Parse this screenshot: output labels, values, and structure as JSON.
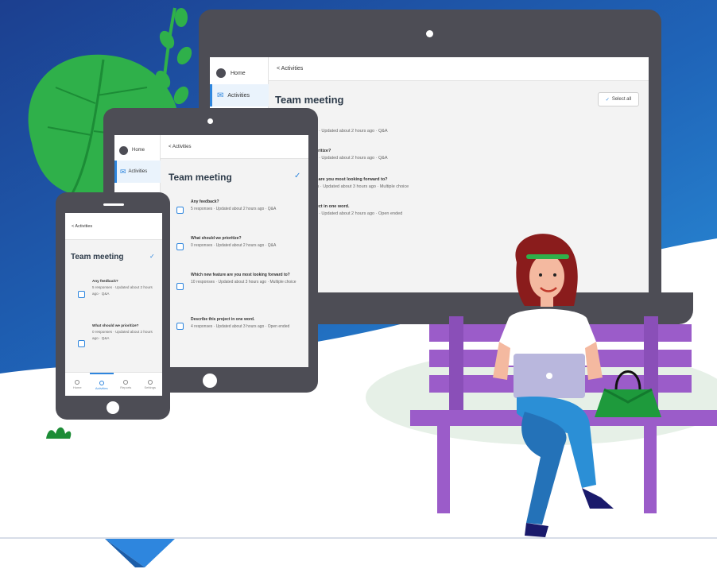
{
  "colors": {
    "bg_top": "#1c3f8f",
    "bg_mid": "#2a8ed8",
    "leaf_green": "#2fb04a",
    "device_frame": "#4d4d55",
    "accent_blue": "#2e86de",
    "bench_purple": "#9b5cc9",
    "woman_hair": "#8a1c1c",
    "jeans_blue": "#2b8fd6",
    "bag_green": "#1e9a3c"
  },
  "laptop": {
    "sidebar": {
      "home_label": "Home",
      "activities_label": "Activities"
    },
    "breadcrumb": "< Activities",
    "title": "Team meeting",
    "select_all_label": "Select all",
    "items": [
      {
        "q": "back?",
        "meta": "esponses · Updated about 2 hours ago · Q&A"
      },
      {
        "q": "d we prioritize?",
        "meta": "esponses · Updated about 2 hours ago · Q&A"
      },
      {
        "q": "e feature are you most looking forward to?",
        "meta": "responses · Updated about 3 hours ago · Multiple choice"
      },
      {
        "q": "this project in one word.",
        "meta": "esponses · Updated about 2 hours ago · Open ended"
      }
    ]
  },
  "tablet": {
    "sidebar": {
      "home_label": "Home",
      "activities_label": "Activities"
    },
    "breadcrumb": "< Activities",
    "title": "Team meeting",
    "items": [
      {
        "q": "Any feedback?",
        "meta": "5 responses · Updated about 2 hours ago · Q&A"
      },
      {
        "q": "What should we prioritize?",
        "meta": "0 responses · Updated about 2 hours ago · Q&A"
      },
      {
        "q": "Which new feature are you most looking forward to?",
        "meta": "10 responses · Updated about 3 hours ago · Multiple choice"
      },
      {
        "q": "Describe this project in one word.",
        "meta": "4 responses · Updated about 3 hours ago · Open ended"
      }
    ]
  },
  "phone": {
    "breadcrumb": "< Activities",
    "title": "Team meeting",
    "items": [
      {
        "q": "Any feedback?",
        "meta": "5 responses · Updated about 2 hours ago · Q&A"
      },
      {
        "q": "What should we prioritize?",
        "meta": "0 responses · Updated about 2 hours ago · Q&A"
      }
    ],
    "tabs": [
      "Home",
      "Activities",
      "Reports",
      "Settings"
    ]
  }
}
